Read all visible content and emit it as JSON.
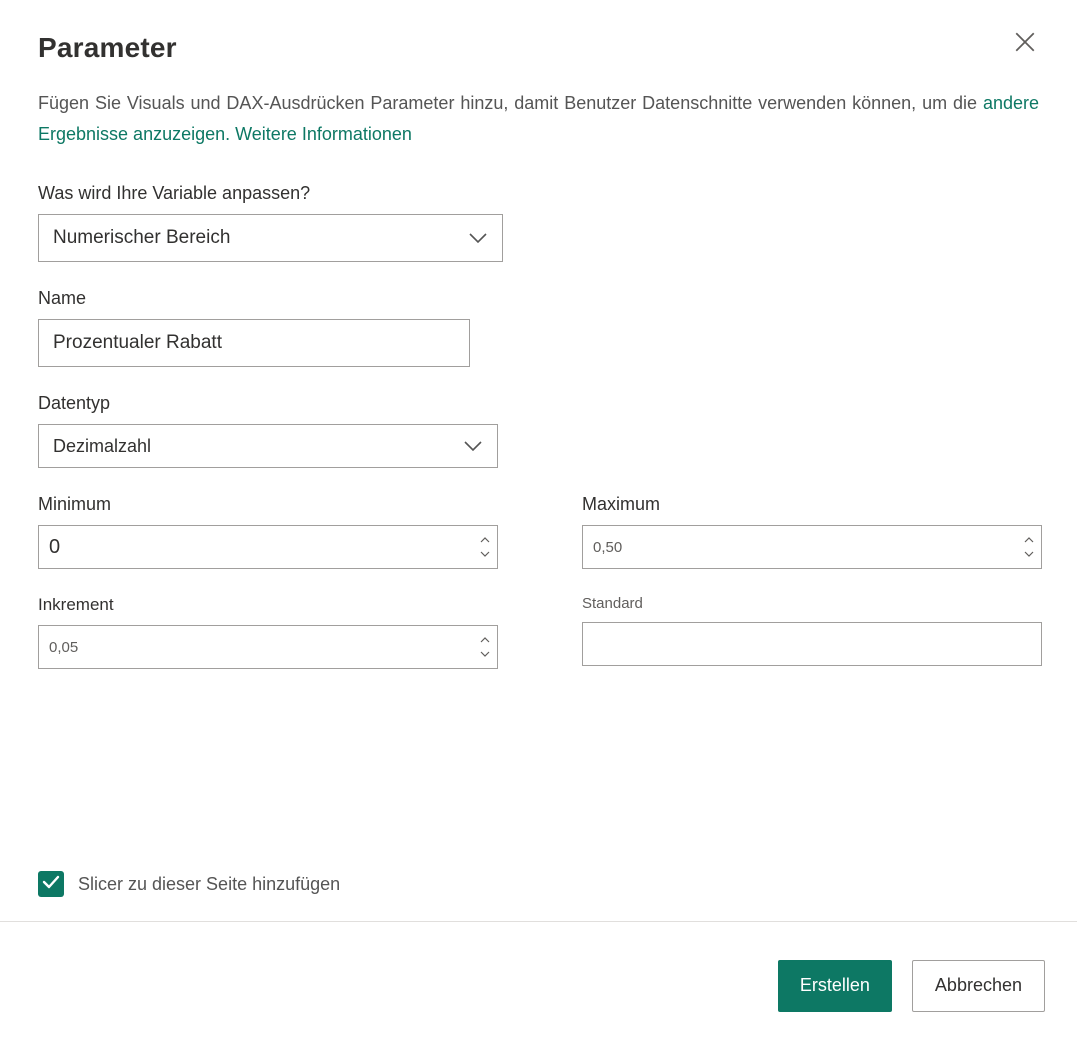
{
  "dialog": {
    "title": "Parameter",
    "intro_plain": "Fügen Sie Visuals und DAX-Ausdrücken Parameter hinzu, damit Benutzer Datenschnitte verwenden können, um die ",
    "intro_link": "andere Ergebnisse anzuzeigen. Weitere Informationen"
  },
  "fields": {
    "adjust_label": "Was wird Ihre Variable anpassen?",
    "adjust_value": "Numerischer Bereich",
    "name_label": "Name",
    "name_value": "Prozentualer Rabatt",
    "datatype_label": "Datentyp",
    "datatype_value": "Dezimalzahl",
    "min_label": "Minimum",
    "min_value": "0",
    "max_label": "Maximum",
    "max_value": "0,50",
    "increment_label": "Inkrement",
    "increment_value": "0,05",
    "default_label": "Standard",
    "default_value": ""
  },
  "checkbox": {
    "label": "Slicer zu dieser Seite hinzufügen",
    "checked": true
  },
  "buttons": {
    "create": "Erstellen",
    "cancel": "Abbrechen"
  }
}
